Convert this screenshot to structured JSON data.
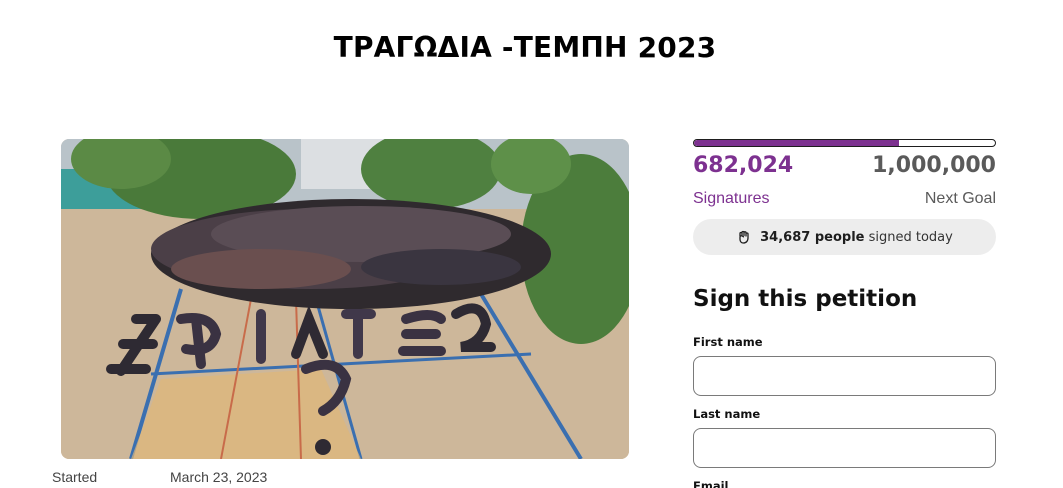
{
  "page": {
    "title": "ΤΡΑΓΩΔΙΑ -ΤΕΜΠΗ 2023"
  },
  "meta": {
    "started_label": "Started",
    "started_date": "March 23, 2023"
  },
  "stats": {
    "signatures": "682,024",
    "signatures_label": "Signatures",
    "goal": "1,000,000",
    "goal_label": "Next Goal",
    "progress_fraction": 0.682,
    "today_count": "34,687 people",
    "today_suffix": "signed today",
    "accent_color": "#7d3190"
  },
  "form": {
    "heading": "Sign this petition",
    "first_name_label": "First name",
    "first_name_value": "",
    "last_name_label": "Last name",
    "last_name_value": "",
    "email_label": "Email"
  },
  "icons": {
    "today": "raised-fist-icon"
  }
}
